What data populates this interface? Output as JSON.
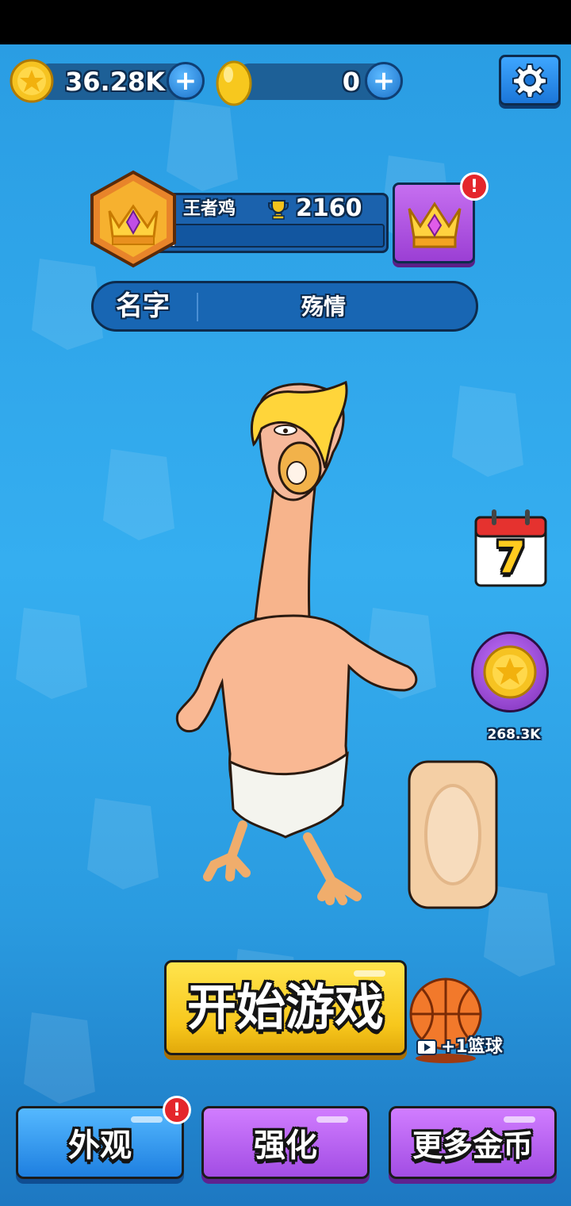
{
  "currency": {
    "coins": "36.28K",
    "eggs": "0",
    "coin_plus_label": "+",
    "egg_plus_label": "+"
  },
  "profile": {
    "rank_title": "王者鸡",
    "trophies": "2160",
    "rank_progress": 0.02,
    "name_label": "名字",
    "name_value": "殇情",
    "badge_alert": "!"
  },
  "side": {
    "calendar_day": "7",
    "coin_reward": "268.3K"
  },
  "actions": {
    "start_label": "开始游戏",
    "ad_reward_label": "+1篮球",
    "appearance_label": "外观",
    "appearance_alert": "!",
    "upgrade_label": "强化",
    "more_coins_label": "更多金币"
  },
  "icons": {
    "settings": "gear-icon",
    "coin": "star-coin-icon",
    "egg": "golden-egg-icon",
    "trophy": "trophy-icon",
    "crown": "crown-icon",
    "calendar": "calendar-icon",
    "basketball": "basketball-icon",
    "video": "video-ad-icon"
  },
  "colors": {
    "accent_yellow": "#f7c71c",
    "accent_blue": "#1e7fe0",
    "accent_purple": "#a24de4",
    "alert_red": "#e4262b"
  }
}
